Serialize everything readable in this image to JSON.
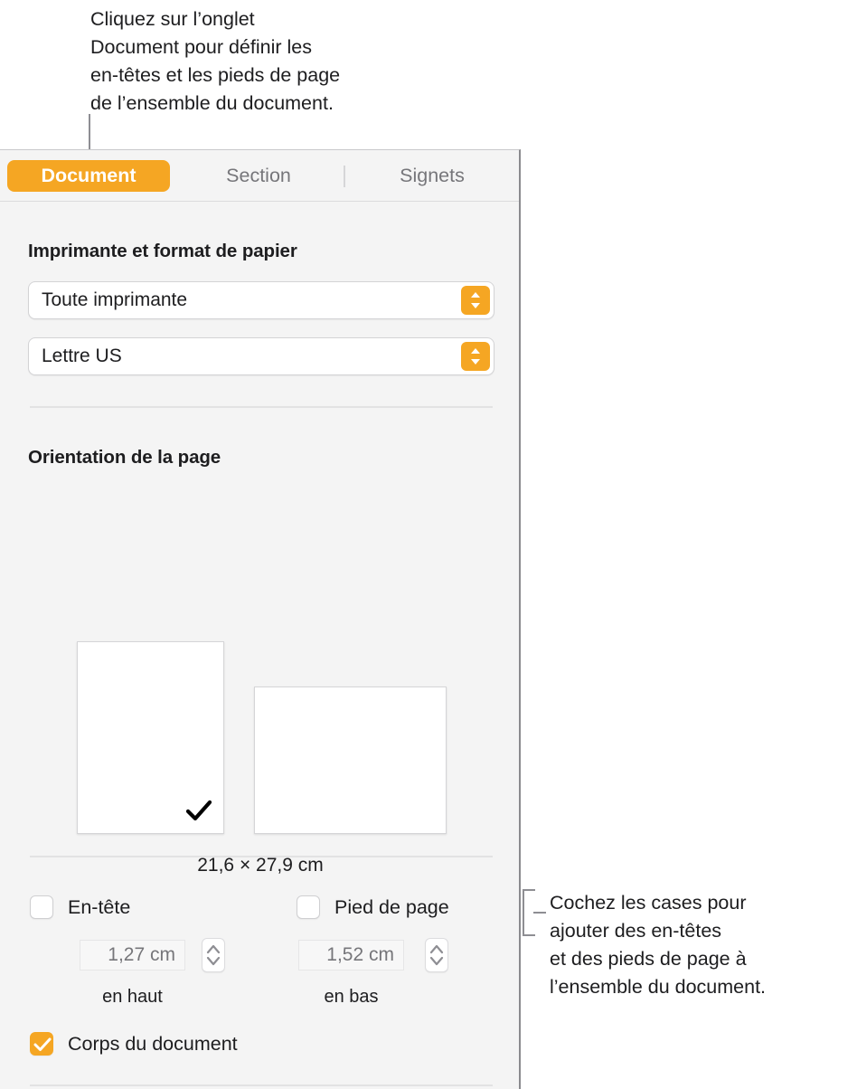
{
  "callouts": {
    "top": "Cliquez sur l’onglet\nDocument pour définir les\nen-têtes et les pieds de page\nde l’ensemble du document.",
    "right": "Cochez les cases pour\najouter des en-têtes\net des pieds de page à\nl’ensemble du document."
  },
  "panel": {
    "tabs": [
      {
        "label": "Document",
        "selected": true
      },
      {
        "label": "Section",
        "selected": false
      },
      {
        "label": "Signets",
        "selected": false
      }
    ],
    "printer_section": {
      "heading": "Imprimante et format de papier",
      "printer": {
        "value": "Toute imprimante"
      },
      "paper": {
        "value": "Lettre US"
      }
    },
    "orientation_section": {
      "heading": "Orientation de la page",
      "portrait": {
        "name": "Portrait",
        "selected": true
      },
      "landscape": {
        "name": "Paysage",
        "selected": false
      },
      "page_size": "21,6 × 27,9 cm"
    },
    "headers_section": {
      "header": {
        "label": "En-tête",
        "checked": false,
        "value": "1,27 cm",
        "sublabel": "en haut"
      },
      "footer": {
        "label": "Pied de page",
        "checked": false,
        "value": "1,52 cm",
        "sublabel": "en bas"
      },
      "body": {
        "label": "Corps du document",
        "checked": true
      }
    }
  },
  "colors": {
    "accent": "#f5a623",
    "panel_bg": "#f4f4f4",
    "text": "#1d1d1f",
    "muted": "#76767a"
  }
}
